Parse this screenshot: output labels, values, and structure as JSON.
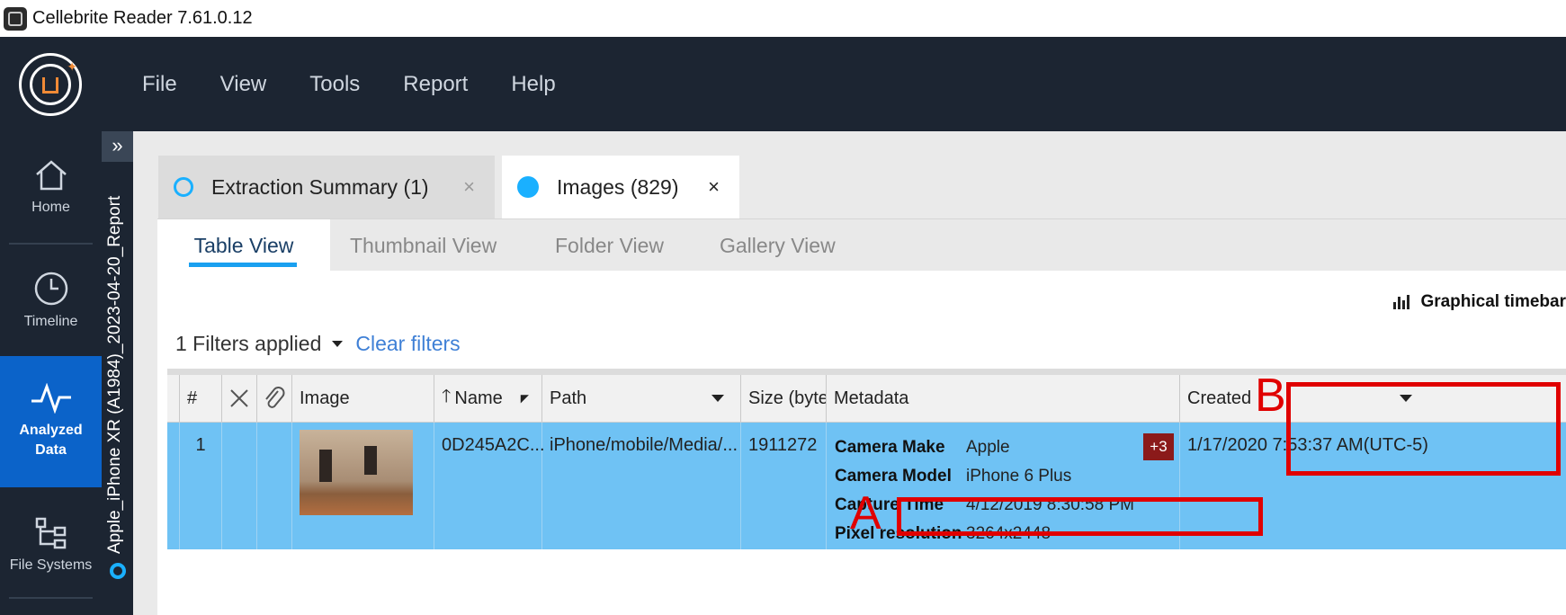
{
  "app": {
    "title": "Cellebrite Reader 7.61.0.12"
  },
  "menu": [
    "File",
    "View",
    "Tools",
    "Report",
    "Help"
  ],
  "nav": {
    "home": "Home",
    "timeline": "Timeline",
    "analyzed": "Analyzed Data",
    "filesystems": "File Systems"
  },
  "report_name": "Apple_iPhone XR (A1984)_2023-04-20_Report",
  "tabs": [
    {
      "label": "Extraction Summary (1)",
      "close": "×"
    },
    {
      "label": "Images (829)",
      "close": "×"
    }
  ],
  "view_tabs": [
    "Table View",
    "Thumbnail View",
    "Folder View",
    "Gallery View"
  ],
  "toolbar": {
    "graphical_timebar": "Graphical timebar"
  },
  "filters": {
    "label": "1 Filters applied",
    "clear": "Clear filters"
  },
  "table": {
    "headers": {
      "num": "#",
      "image": "Image",
      "name": "Name",
      "path": "Path",
      "size": "Size (byte:",
      "metadata": "Metadata",
      "created": "Created"
    },
    "rows": [
      {
        "num": "1",
        "name": "0D245A2C...",
        "path": "iPhone/mobile/Media/...",
        "size": "1911272",
        "metadata": [
          {
            "key": "Camera Make",
            "value": "Apple"
          },
          {
            "key": "Camera Model",
            "value": "iPhone 6 Plus"
          },
          {
            "key": "Capture Time",
            "value": "4/12/2019 8:30:58 PM"
          },
          {
            "key": "Pixel resolution",
            "value": "3264x2448"
          }
        ],
        "more": "+3",
        "created": "1/17/2020 7:53:37 AM(UTC-5)"
      }
    ]
  },
  "annotations": {
    "a": "A",
    "b": "B",
    "color": "#e00000"
  },
  "colors": {
    "menubar": "#1c2532",
    "active_nav": "#0b63c9",
    "row_selected": "#6fc2f4",
    "accent": "#1ab0ff"
  }
}
